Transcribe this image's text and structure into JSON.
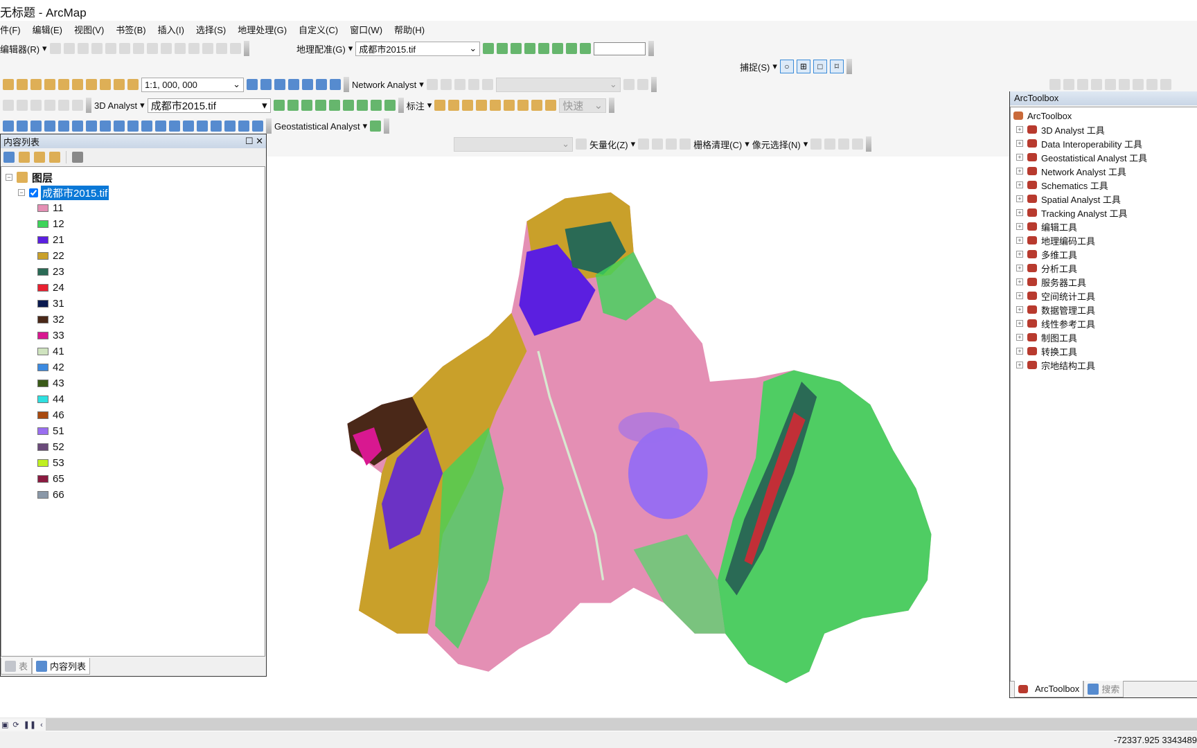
{
  "window": {
    "title": "无标题 - ArcMap"
  },
  "menu": [
    "件(F)",
    "编辑(E)",
    "视图(V)",
    "书签(B)",
    "插入(I)",
    "选择(S)",
    "地理处理(G)",
    "自定义(C)",
    "窗口(W)",
    "帮助(H)"
  ],
  "toolbars": {
    "editor_label": "编辑器(R)",
    "georef_label": "地理配准(G)",
    "georef_layer": "成都市2015.tif",
    "georef_input": "",
    "snap_label": "捕捉(S)",
    "scale": "1:1, 000, 000",
    "network_label": "Network Analyst",
    "analyst3d_label": "3D Analyst",
    "analyst3d_layer": "成都市2015.tif",
    "label_label": "标注",
    "label_speed": "快速",
    "geostat_label": "Geostatistical Analyst",
    "vectorize_label": "矢量化(Z)",
    "raster_clean_label": "栅格清理(C)",
    "cell_select_label": "像元选择(N)"
  },
  "toc": {
    "title": "内容列表",
    "root": "图层",
    "layer": "成都市2015.tif",
    "layer_checked": true,
    "classes": [
      {
        "value": "11",
        "color": "#e48fb4"
      },
      {
        "value": "12",
        "color": "#3ed45a"
      },
      {
        "value": "21",
        "color": "#5b1fe0"
      },
      {
        "value": "22",
        "color": "#c9a02a"
      },
      {
        "value": "23",
        "color": "#2a6a55"
      },
      {
        "value": "24",
        "color": "#e82030"
      },
      {
        "value": "31",
        "color": "#0a1a50"
      },
      {
        "value": "32",
        "color": "#4a2818"
      },
      {
        "value": "33",
        "color": "#d81890"
      },
      {
        "value": "41",
        "color": "#cfe3bf"
      },
      {
        "value": "42",
        "color": "#3c8ae0"
      },
      {
        "value": "43",
        "color": "#3a5a18"
      },
      {
        "value": "44",
        "color": "#2ee0e0"
      },
      {
        "value": "46",
        "color": "#a84a10"
      },
      {
        "value": "51",
        "color": "#9a6ef0"
      },
      {
        "value": "52",
        "color": "#6a4a7a"
      },
      {
        "value": "53",
        "color": "#c0f020"
      },
      {
        "value": "65",
        "color": "#8a1a40"
      },
      {
        "value": "66",
        "color": "#8a98a8"
      }
    ],
    "tabs": [
      "表",
      "内容列表"
    ]
  },
  "toolbox": {
    "title": "ArcToolbox",
    "root": "ArcToolbox",
    "items": [
      "3D Analyst 工具",
      "Data Interoperability 工具",
      "Geostatistical Analyst 工具",
      "Network Analyst 工具",
      "Schematics 工具",
      "Spatial Analyst 工具",
      "Tracking Analyst 工具",
      "编辑工具",
      "地理编码工具",
      "多维工具",
      "分析工具",
      "服务器工具",
      "空间统计工具",
      "数据管理工具",
      "线性参考工具",
      "制图工具",
      "转换工具",
      "宗地结构工具"
    ],
    "tabs": [
      "ArcToolbox",
      "搜索"
    ]
  },
  "status": {
    "coords": "-72337.925  3343489"
  }
}
